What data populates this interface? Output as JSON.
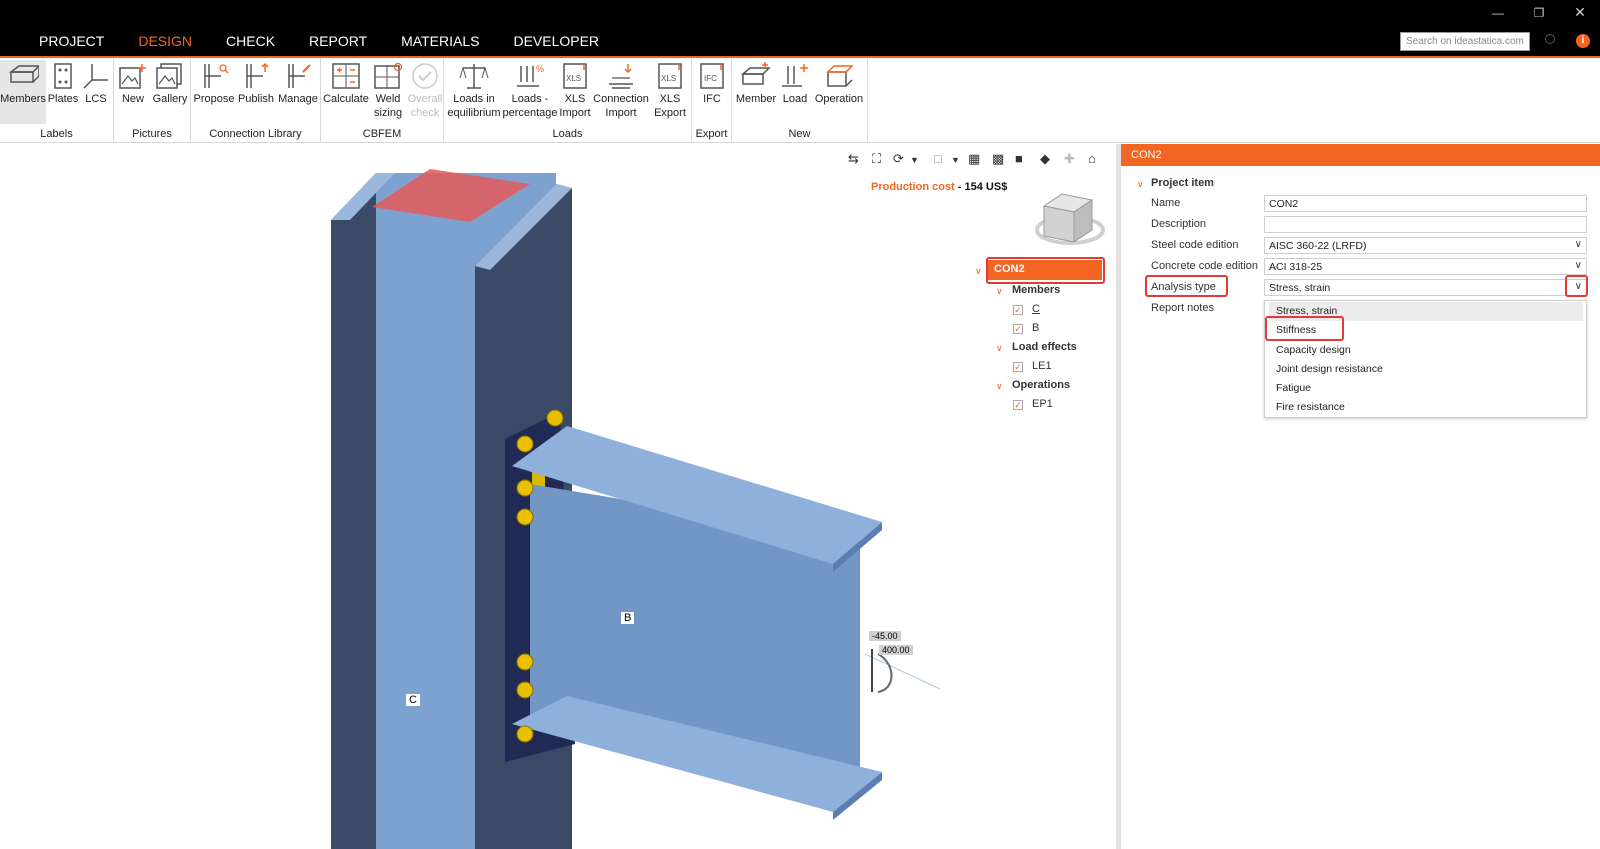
{
  "menu": {
    "tabs": [
      {
        "label": "PROJECT"
      },
      {
        "label": "DESIGN"
      },
      {
        "label": "CHECK"
      },
      {
        "label": "REPORT"
      },
      {
        "label": "MATERIALS"
      },
      {
        "label": "DEVELOPER"
      }
    ],
    "active_tab": "DESIGN",
    "search_placeholder": "Search on ideastatica.com",
    "info": "i"
  },
  "ribbon": {
    "groups": [
      {
        "label": "Labels",
        "buttons": [
          "Members",
          "Plates",
          "LCS"
        ]
      },
      {
        "label": "Pictures",
        "buttons": [
          "New",
          "Gallery"
        ]
      },
      {
        "label": "Connection Library",
        "buttons": [
          "Propose",
          "Publish",
          "Manage"
        ]
      },
      {
        "label": "CBFEM",
        "buttons": [
          "Calculate",
          "Weld sizing",
          "Overall check"
        ]
      },
      {
        "label": "Loads",
        "buttons": [
          "Loads in equilibrium",
          "Loads - percentage",
          "XLS Import",
          "Connection Import",
          "XLS Export"
        ]
      },
      {
        "label": "Export",
        "buttons": [
          "IFC"
        ]
      },
      {
        "label": "New",
        "buttons": [
          "Member",
          "Load",
          "Operation"
        ]
      }
    ]
  },
  "viewport": {
    "production_cost_label": "Production cost",
    "production_cost_value": "- 154 US$",
    "member_labels": {
      "column": "C",
      "beam": "B"
    },
    "dim1": "-45.00",
    "dim2": "400.00"
  },
  "tree": {
    "root": "CON2",
    "sections": [
      {
        "label": "Members",
        "items": [
          "C",
          "B"
        ]
      },
      {
        "label": "Load effects",
        "items": [
          "LE1"
        ]
      },
      {
        "label": "Operations",
        "items": [
          "EP1"
        ]
      }
    ]
  },
  "properties": {
    "header": "CON2",
    "section": "Project item",
    "fields": [
      {
        "label": "Name",
        "value": "CON2"
      },
      {
        "label": "Description",
        "value": ""
      },
      {
        "label": "Steel code edition",
        "value": "AISC 360-22 (LRFD)"
      },
      {
        "label": "Concrete code edition",
        "value": "ACI 318-25"
      },
      {
        "label": "Analysis type",
        "value": "Stress, strain"
      },
      {
        "label": "Report notes",
        "value": ""
      }
    ],
    "dropdown_options": [
      "Stress, strain",
      "Stiffness",
      "Capacity design",
      "Joint design resistance",
      "Fatigue",
      "Fire resistance"
    ]
  },
  "colors": {
    "accent": "#f26522",
    "steel": "#7ea2cf",
    "bolt": "#e8c000",
    "highlight": "#e53935"
  }
}
